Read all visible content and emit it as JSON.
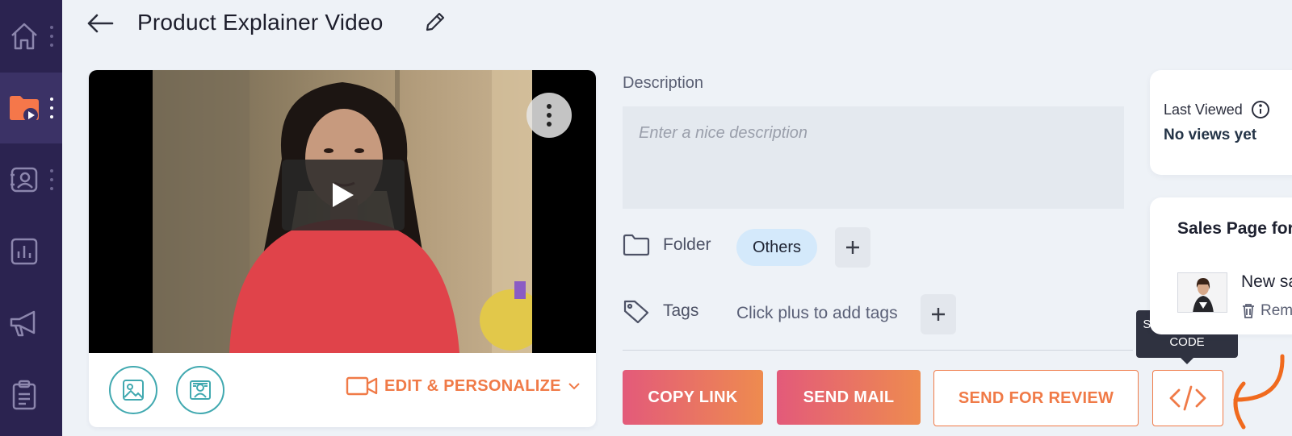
{
  "header": {
    "title": "Product Explainer Video"
  },
  "sidebar": {
    "items": [
      {
        "icon": "home-icon"
      },
      {
        "icon": "video-folder-icon",
        "active": true
      },
      {
        "icon": "contacts-icon"
      },
      {
        "icon": "analytics-icon"
      },
      {
        "icon": "megaphone-icon"
      },
      {
        "icon": "clipboard-icon"
      }
    ]
  },
  "video": {
    "edit_personalize_label": "EDIT & PERSONALIZE"
  },
  "details": {
    "description_label": "Description",
    "description_placeholder": "Enter a nice description",
    "folder_label": "Folder",
    "folder_value": "Others",
    "tags_label": "Tags",
    "tags_hint": "Click plus to add tags"
  },
  "actions": {
    "copy_link": "COPY LINK",
    "send_mail": "SEND MAIL",
    "send_for_review": "SEND FOR REVIEW",
    "embed_tooltip_line1": "SHARE/EMBED",
    "embed_tooltip_line2": "CODE"
  },
  "right_panel": {
    "last_viewed_label": "Last Viewed",
    "last_viewed_value": "No views yet",
    "sales_page_title": "Sales Page for",
    "sales_item_name": "New sa",
    "sales_item_remove": "Rem"
  },
  "colors": {
    "accent_orange": "#f07a47",
    "gradient_start": "#e35a7a",
    "gradient_end": "#ee8b4f",
    "sidebar_bg": "#2b2350",
    "teal": "#41a9b0"
  }
}
